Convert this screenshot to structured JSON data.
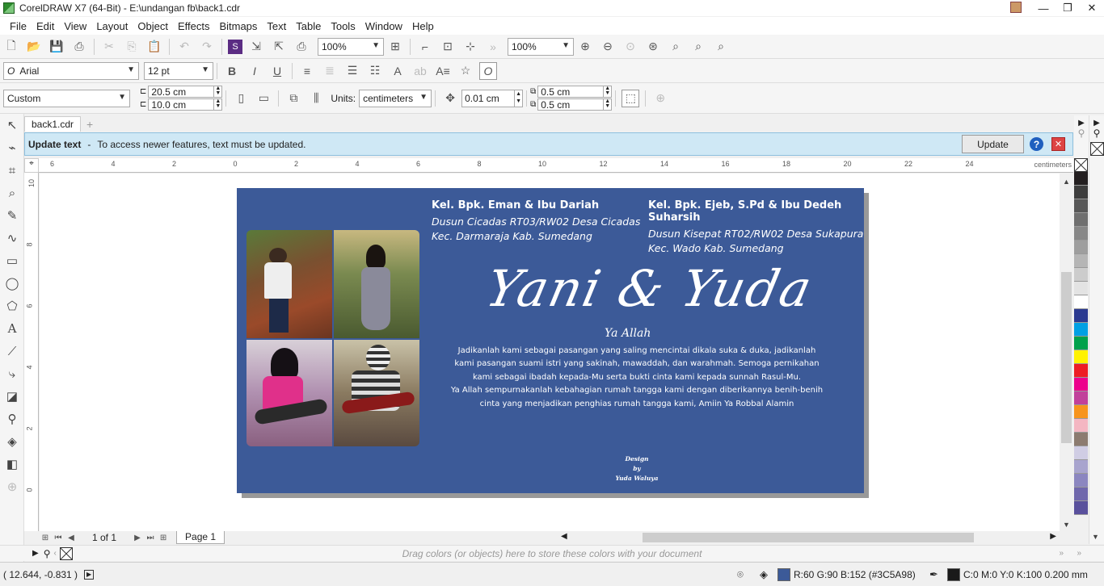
{
  "window": {
    "title": "CorelDRAW X7 (64-Bit) - E:\\undangan fb\\back1.cdr",
    "minimize": "—",
    "restore": "❐",
    "close": "✕"
  },
  "menu": [
    "File",
    "Edit",
    "View",
    "Layout",
    "Object",
    "Effects",
    "Bitmaps",
    "Text",
    "Table",
    "Tools",
    "Window",
    "Help"
  ],
  "toolbar1": {
    "zoom_left": "100%",
    "zoom_right": "100%"
  },
  "toolbar2": {
    "font": "Arial",
    "size": "12 pt"
  },
  "toolbar3": {
    "preset": "Custom",
    "width": "20.5 cm",
    "height": "10.0 cm",
    "units_label": "Units:",
    "units": "centimeters",
    "nudge": "0.01 cm",
    "dup_x": "0.5 cm",
    "dup_y": "0.5 cm"
  },
  "tabs": {
    "doc": "back1.cdr"
  },
  "infobar": {
    "title": "Update text",
    "dash": "-",
    "message": "To access newer features, text must be updated.",
    "button": "Update"
  },
  "ruler": {
    "units": "centimeters",
    "h_ticks": [
      "6",
      "4",
      "2",
      "0",
      "2",
      "4",
      "6",
      "8",
      "10",
      "12",
      "14",
      "16",
      "18",
      "20",
      "22",
      "24"
    ],
    "v_ticks": [
      "10",
      "8",
      "6",
      "4",
      "2",
      "0"
    ]
  },
  "design": {
    "family_left": {
      "name": "Kel. Bpk. Eman & Ibu Dariah",
      "line1": "Dusun Cicadas RT03/RW02 Desa Cicadas",
      "line2": "Kec. Darmaraja Kab. Sumedang"
    },
    "family_right": {
      "name": "Kel. Bpk. Ejeb, S.Pd & Ibu Dedeh Suharsih",
      "line1": "Dusun Kisepat RT02/RW02 Desa Sukapura",
      "line2": "Kec. Wado Kab. Sumedang"
    },
    "couple": "Yani & Yuda",
    "ya_allah": "Ya Allah",
    "prayer": [
      "Jadikanlah kami sebagai pasangan yang saling mencintai dikala suka & duka, jadikanlah",
      "kami pasangan suami istri yang sakinah, mawaddah, dan warahmah. Semoga pernikahan",
      "kami sebagai ibadah kepada-Mu serta bukti cinta kami kepada sunnah Rasul-Mu.",
      "Ya Allah sempurnakanlah kebahagian rumah tangga kami dengan diberikannya benih-benih",
      "cinta yang menjadikan penghias rumah tangga kami, Amiin Ya Robbal Alamin"
    ],
    "credit": {
      "l1": "Design",
      "l2": "by",
      "l3": "Yuda Waluya"
    }
  },
  "pagenav": {
    "count": "1 of 1",
    "page": "Page 1"
  },
  "colorbar": {
    "hint": "Drag colors (or objects) here to store these colors with your document"
  },
  "status": {
    "coords": "( 12.644, -0.831 )",
    "fill_text": "R:60 G:90 B:152 (#3C5A98)",
    "outline_text": "C:0 M:0 Y:0 K:100  0.200 mm"
  },
  "colors": {
    "page_fill": "#3c5a98",
    "outline": "#1a1a1a"
  },
  "palette": [
    "#231f20",
    "#3d3d3d",
    "#575757",
    "#6f6f6f",
    "#878787",
    "#9e9e9e",
    "#b5b5b5",
    "#cccccc",
    "#e3e3e3",
    "#ffffff",
    "#2a3990",
    "#00a0e3",
    "#00a14b",
    "#fff200",
    "#ed1c24",
    "#ec008c",
    "#c1409b",
    "#f7941d",
    "#f4b6c2",
    "#8c7b70",
    "#d0cde4",
    "#a8a4ce",
    "#8b86c0",
    "#6f67ac",
    "#59509c"
  ]
}
